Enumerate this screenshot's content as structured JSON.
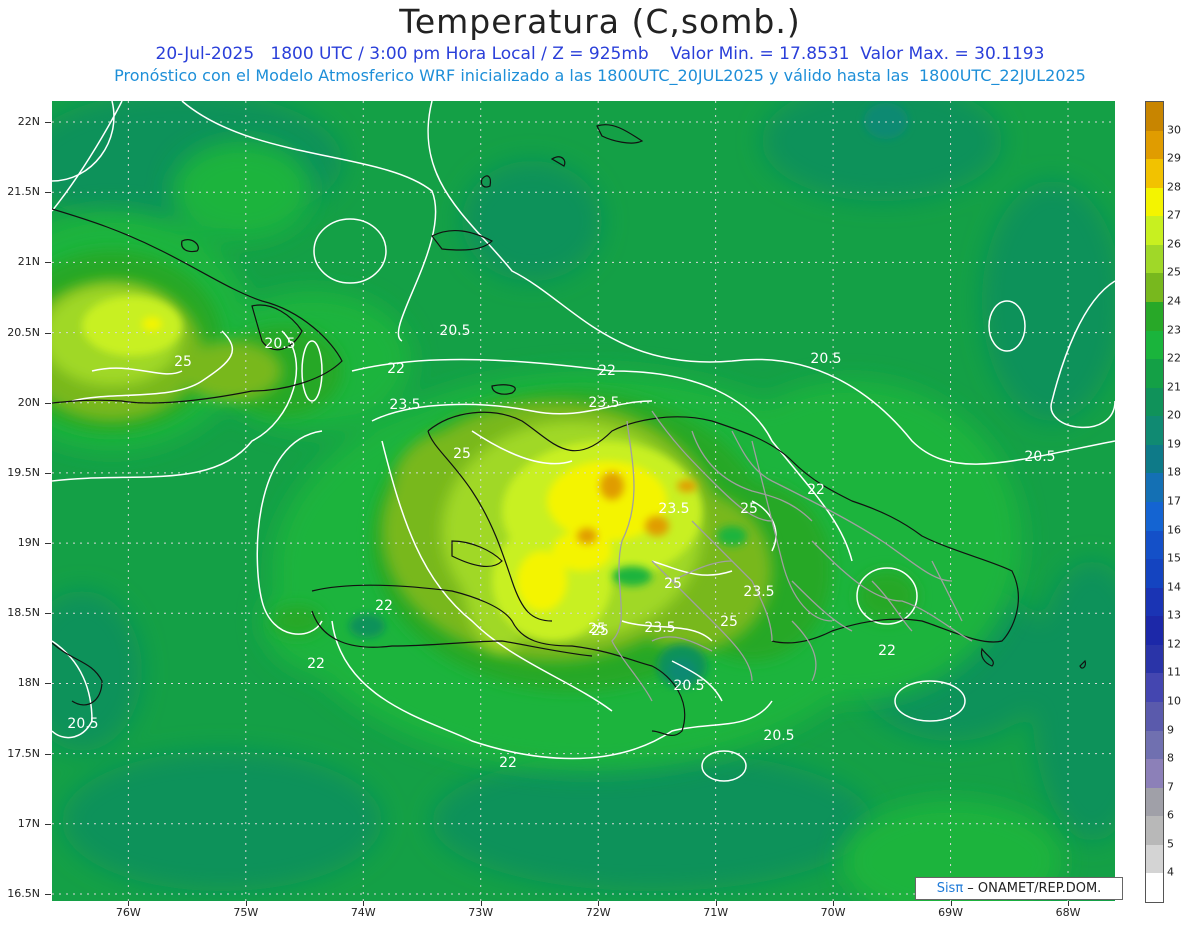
{
  "header": {
    "title": "Temperatura (C,somb.)",
    "line1": "20-Jul-2025   1800 UTC / 3:00 pm Hora Local / Z = 925mb    Valor Min. = 17.8531  Valor Max. = 30.1193",
    "line2": "Pronóstico con el Modelo Atmosferico WRF inicializado a las 1800UTC_20JUL2025 y válido hasta las  1800UTC_22JUL2025"
  },
  "axes": {
    "lat_labels": [
      "22N",
      "21.5N",
      "21N",
      "20.5N",
      "20N",
      "19.5N",
      "19N",
      "18.5N",
      "18N",
      "17.5N",
      "17N",
      "16.5N"
    ],
    "lat_values": [
      22,
      21.5,
      21,
      20.5,
      20,
      19.5,
      19,
      18.5,
      18,
      17.5,
      17,
      16.5
    ],
    "lon_labels": [
      "76W",
      "75W",
      "74W",
      "73W",
      "72W",
      "71W",
      "70W",
      "69W",
      "68W"
    ],
    "lon_values": [
      -76,
      -75,
      -74,
      -73,
      -72,
      -71,
      -70,
      -69,
      -68
    ],
    "lon_range": [
      -76.65,
      -67.6
    ],
    "lat_range": [
      16.45,
      22.15
    ],
    "grid": "dotted"
  },
  "colorbar": {
    "labels": [
      "30",
      "29",
      "28",
      "27",
      "26",
      "25",
      "24",
      "23",
      "22",
      "21",
      "20",
      "19",
      "18",
      "17",
      "16",
      "15",
      "14",
      "13",
      "12",
      "11",
      "10",
      "9",
      "8",
      "7",
      "6",
      "5",
      "4"
    ],
    "colors": [
      "#c88500",
      "#e09c00",
      "#f2c200",
      "#f4f400",
      "#c8f020",
      "#a0d828",
      "#78b81e",
      "#28a828",
      "#1ab43c",
      "#14a046",
      "#10925a",
      "#108a72",
      "#0e7a88",
      "#1470b4",
      "#1464d2",
      "#1450c8",
      "#1444c0",
      "#1a34b4",
      "#1c28a8",
      "#2a34a8",
      "#4446b0",
      "#5a5aac",
      "#7070b0",
      "#8c80b8",
      "#a0a0a8",
      "#b8b8b8",
      "#d4d4d4",
      "#ffffff"
    ]
  },
  "contours": {
    "labels": [
      "20.5",
      "20.5",
      "22",
      "22",
      "23.5",
      "23.5",
      "25",
      "25",
      "20.5",
      "20.5",
      "22",
      "23.5",
      "25",
      "22",
      "22",
      "25",
      "23.5",
      "25",
      "23.5",
      "25",
      "25",
      "22",
      "20.5",
      "20.5",
      "22",
      "20.5"
    ]
  },
  "credit": {
    "brand": "Sisπ",
    "text": " – ONAMET/REP.DOM."
  }
}
